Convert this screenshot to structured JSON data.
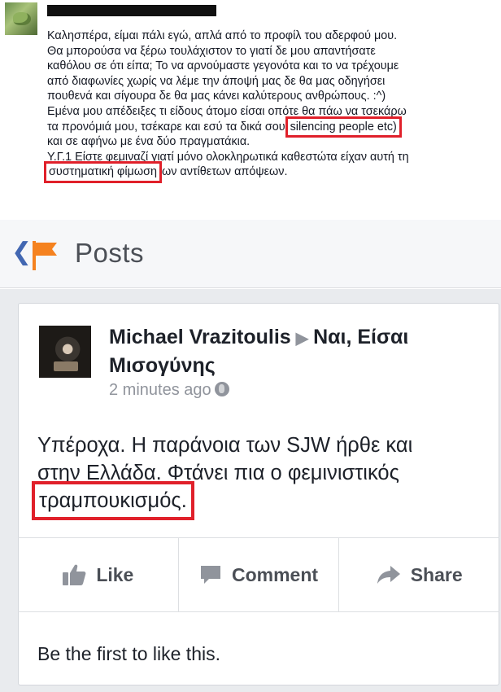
{
  "comment": {
    "lines": [
      "Καλησπέρα, είμαι πάλι εγώ, απλά από το προφίλ του αδερφού μου.",
      "Θα μπορούσα να ξέρω τουλάχιστον το γιατί δε μου απαντήσατε",
      "καθόλου σε ότι είπα; Το να αρνούμαστε γεγονότα και το να τρέχουμε",
      "από διαφωνίες χωρίς να λέμε την άποψή μας δε θα μας οδηγήσει",
      "πουθενά και σίγουρα δε θα μας κάνει καλύτερους ανθρώπους. :^)",
      "Εμένα μου απέδειξες τι είδους άτομο είσαι οπότε θα πάω να τσεκάρω",
      "τα προνόμιά μου, τσέκαρε και εσύ τα δικά σου",
      "και σε αφήνω με ένα δύο πραγματάκια.",
      "Υ.Γ.1 Είστε φεμιναζί γιατί μόνο ολοκληρωτικά καθεστώτα είχαν αυτή τη",
      "ων αντίθετων απόψεων."
    ],
    "highlight_1": "silencing people etc)",
    "highlight_2": "συστηματική φίμωση"
  },
  "header": {
    "back_icon": "chevron-left-icon",
    "flag_icon": "orange-flag-icon",
    "title": "Posts"
  },
  "post": {
    "author": "Michael Vrazitoulis",
    "target": "Ναι, Είσαι Μισογύνης",
    "time": "2 minutes ago",
    "text_lines": [
      "Υπέροχα. Η παράνοια των SJW ήρθε και",
      "στην Ελλάδα. Φτάνει πια ο φεμινιστικός"
    ],
    "text_highlight": "τραμπουκισμός."
  },
  "actions": {
    "like": "Like",
    "comment": "Comment",
    "share": "Share"
  },
  "footer": {
    "first_like": "Be the first to like this."
  },
  "colors": {
    "highlight": "#e0202a",
    "link_blue": "#4267b2",
    "flag_orange": "#f5821f"
  }
}
